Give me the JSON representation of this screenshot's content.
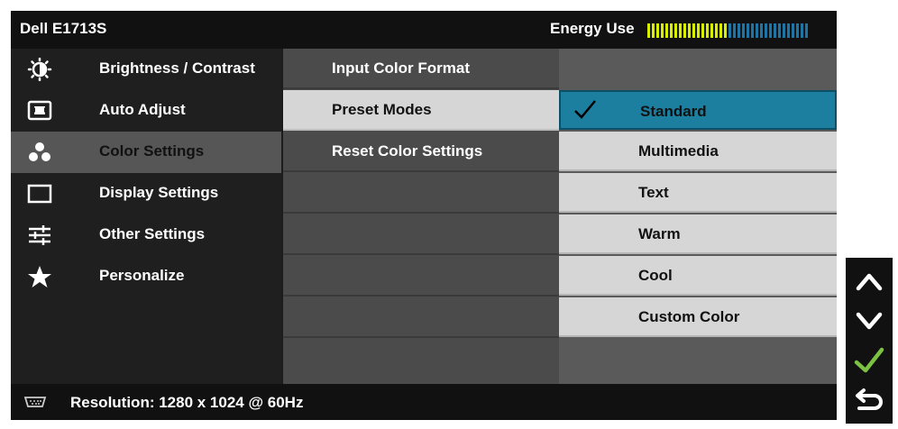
{
  "header": {
    "title": "Dell E1713S",
    "energy_label": "Energy Use",
    "energy_level_fraction": 0.5
  },
  "main_menu": [
    {
      "label": "Brightness / Contrast",
      "icon": "brightness-icon"
    },
    {
      "label": "Auto Adjust",
      "icon": "auto-adjust-icon"
    },
    {
      "label": "Color Settings",
      "icon": "color-settings-icon",
      "selected": true
    },
    {
      "label": "Display Settings",
      "icon": "display-icon"
    },
    {
      "label": "Other Settings",
      "icon": "sliders-icon"
    },
    {
      "label": "Personalize",
      "icon": "star-icon"
    }
  ],
  "submenu": [
    {
      "label": "Input Color Format"
    },
    {
      "label": "Preset Modes",
      "selected": true
    },
    {
      "label": "Reset Color Settings"
    }
  ],
  "preset_modes": [
    {
      "label": "Standard",
      "selected": true,
      "checked": true
    },
    {
      "label": "Multimedia"
    },
    {
      "label": "Text"
    },
    {
      "label": "Warm"
    },
    {
      "label": "Cool"
    },
    {
      "label": "Custom Color"
    }
  ],
  "status": {
    "text": "Resolution: 1280 x 1024 @ 60Hz"
  },
  "buttons": [
    {
      "icon": "up-arrow-icon"
    },
    {
      "icon": "down-arrow-icon"
    },
    {
      "icon": "check-icon"
    },
    {
      "icon": "back-icon"
    }
  ],
  "colors": {
    "accent": "#1d7fa0",
    "energy_on": "#d8f000",
    "energy_off": "#1f74a6",
    "check": "#7cc242"
  }
}
